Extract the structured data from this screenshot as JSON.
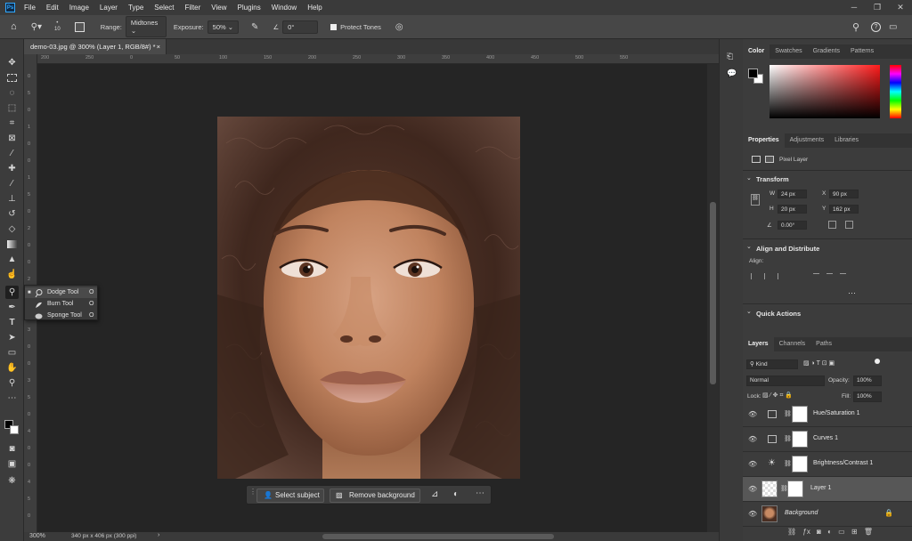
{
  "menubar": {
    "items": [
      "File",
      "Edit",
      "Image",
      "Layer",
      "Type",
      "Select",
      "Filter",
      "View",
      "Plugins",
      "Window",
      "Help"
    ],
    "logo": "Ps"
  },
  "options": {
    "brush_size": "10",
    "range_label": "Range:",
    "range_value": "Midtones",
    "exposure_label": "Exposure:",
    "exposure_value": "50%",
    "angle_value": "0°",
    "protect_tones": "Protect Tones"
  },
  "document": {
    "tab_title": "demo-03.jpg @ 300% (Layer 1, RGB/8#) *",
    "zoom": "300%",
    "doc_info": "340 px x 406 px (300 ppi)"
  },
  "ruler": {
    "h_ticks": [
      "200",
      "250",
      "0",
      "50",
      "100",
      "150",
      "200",
      "250",
      "300",
      "350",
      "400",
      "450",
      "500",
      "550"
    ],
    "v_ticks": [
      "0",
      "5",
      "0",
      "1",
      "0",
      "0",
      "1",
      "5",
      "0",
      "2",
      "0",
      "0",
      "2",
      "5",
      "0",
      "3",
      "0",
      "0",
      "3",
      "5",
      "0",
      "4",
      "0",
      "0",
      "4",
      "5",
      "0"
    ]
  },
  "flyout": {
    "items": [
      {
        "label": "Dodge Tool",
        "shortcut": "O"
      },
      {
        "label": "Burn Tool",
        "shortcut": "O"
      },
      {
        "label": "Sponge Tool",
        "shortcut": "O"
      }
    ]
  },
  "contextbar": {
    "select_subject": "Select subject",
    "remove_background": "Remove background"
  },
  "color_panel": {
    "tabs": [
      "Color",
      "Swatches",
      "Gradients",
      "Patterns"
    ]
  },
  "properties": {
    "tabs": [
      "Properties",
      "Adjustments",
      "Libraries"
    ],
    "layer_type": "Pixel Layer",
    "transform": "Transform",
    "w_label": "W",
    "w": "24 px",
    "h_label": "H",
    "h": "20 px",
    "x_label": "X",
    "x": "90 px",
    "y_label": "Y",
    "y": "162 px",
    "angle": "0.00°",
    "align": "Align and Distribute",
    "align_label": "Align:",
    "quick_actions": "Quick Actions"
  },
  "layers_panel": {
    "tabs": [
      "Layers",
      "Channels",
      "Paths"
    ],
    "kind": "Kind",
    "blend": "Normal",
    "opacity_label": "Opacity:",
    "opacity": "100%",
    "lock_label": "Lock:",
    "fill_label": "Fill:",
    "fill": "100%",
    "layers": [
      "Hue/Saturation 1",
      "Curves 1",
      "Brightness/Contrast 1",
      "Layer 1",
      "Background"
    ]
  }
}
